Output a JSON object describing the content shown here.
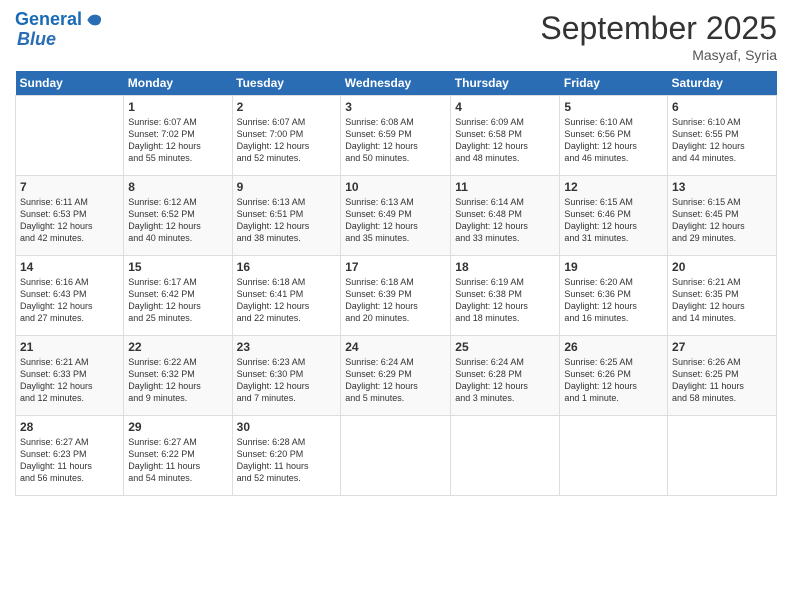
{
  "header": {
    "logo_line1": "General",
    "logo_line2": "Blue",
    "month": "September 2025",
    "location": "Masyaf, Syria"
  },
  "weekdays": [
    "Sunday",
    "Monday",
    "Tuesday",
    "Wednesday",
    "Thursday",
    "Friday",
    "Saturday"
  ],
  "weeks": [
    [
      {
        "day": "",
        "info": ""
      },
      {
        "day": "1",
        "info": "Sunrise: 6:07 AM\nSunset: 7:02 PM\nDaylight: 12 hours\nand 55 minutes."
      },
      {
        "day": "2",
        "info": "Sunrise: 6:07 AM\nSunset: 7:00 PM\nDaylight: 12 hours\nand 52 minutes."
      },
      {
        "day": "3",
        "info": "Sunrise: 6:08 AM\nSunset: 6:59 PM\nDaylight: 12 hours\nand 50 minutes."
      },
      {
        "day": "4",
        "info": "Sunrise: 6:09 AM\nSunset: 6:58 PM\nDaylight: 12 hours\nand 48 minutes."
      },
      {
        "day": "5",
        "info": "Sunrise: 6:10 AM\nSunset: 6:56 PM\nDaylight: 12 hours\nand 46 minutes."
      },
      {
        "day": "6",
        "info": "Sunrise: 6:10 AM\nSunset: 6:55 PM\nDaylight: 12 hours\nand 44 minutes."
      }
    ],
    [
      {
        "day": "7",
        "info": "Sunrise: 6:11 AM\nSunset: 6:53 PM\nDaylight: 12 hours\nand 42 minutes."
      },
      {
        "day": "8",
        "info": "Sunrise: 6:12 AM\nSunset: 6:52 PM\nDaylight: 12 hours\nand 40 minutes."
      },
      {
        "day": "9",
        "info": "Sunrise: 6:13 AM\nSunset: 6:51 PM\nDaylight: 12 hours\nand 38 minutes."
      },
      {
        "day": "10",
        "info": "Sunrise: 6:13 AM\nSunset: 6:49 PM\nDaylight: 12 hours\nand 35 minutes."
      },
      {
        "day": "11",
        "info": "Sunrise: 6:14 AM\nSunset: 6:48 PM\nDaylight: 12 hours\nand 33 minutes."
      },
      {
        "day": "12",
        "info": "Sunrise: 6:15 AM\nSunset: 6:46 PM\nDaylight: 12 hours\nand 31 minutes."
      },
      {
        "day": "13",
        "info": "Sunrise: 6:15 AM\nSunset: 6:45 PM\nDaylight: 12 hours\nand 29 minutes."
      }
    ],
    [
      {
        "day": "14",
        "info": "Sunrise: 6:16 AM\nSunset: 6:43 PM\nDaylight: 12 hours\nand 27 minutes."
      },
      {
        "day": "15",
        "info": "Sunrise: 6:17 AM\nSunset: 6:42 PM\nDaylight: 12 hours\nand 25 minutes."
      },
      {
        "day": "16",
        "info": "Sunrise: 6:18 AM\nSunset: 6:41 PM\nDaylight: 12 hours\nand 22 minutes."
      },
      {
        "day": "17",
        "info": "Sunrise: 6:18 AM\nSunset: 6:39 PM\nDaylight: 12 hours\nand 20 minutes."
      },
      {
        "day": "18",
        "info": "Sunrise: 6:19 AM\nSunset: 6:38 PM\nDaylight: 12 hours\nand 18 minutes."
      },
      {
        "day": "19",
        "info": "Sunrise: 6:20 AM\nSunset: 6:36 PM\nDaylight: 12 hours\nand 16 minutes."
      },
      {
        "day": "20",
        "info": "Sunrise: 6:21 AM\nSunset: 6:35 PM\nDaylight: 12 hours\nand 14 minutes."
      }
    ],
    [
      {
        "day": "21",
        "info": "Sunrise: 6:21 AM\nSunset: 6:33 PM\nDaylight: 12 hours\nand 12 minutes."
      },
      {
        "day": "22",
        "info": "Sunrise: 6:22 AM\nSunset: 6:32 PM\nDaylight: 12 hours\nand 9 minutes."
      },
      {
        "day": "23",
        "info": "Sunrise: 6:23 AM\nSunset: 6:30 PM\nDaylight: 12 hours\nand 7 minutes."
      },
      {
        "day": "24",
        "info": "Sunrise: 6:24 AM\nSunset: 6:29 PM\nDaylight: 12 hours\nand 5 minutes."
      },
      {
        "day": "25",
        "info": "Sunrise: 6:24 AM\nSunset: 6:28 PM\nDaylight: 12 hours\nand 3 minutes."
      },
      {
        "day": "26",
        "info": "Sunrise: 6:25 AM\nSunset: 6:26 PM\nDaylight: 12 hours\nand 1 minute."
      },
      {
        "day": "27",
        "info": "Sunrise: 6:26 AM\nSunset: 6:25 PM\nDaylight: 11 hours\nand 58 minutes."
      }
    ],
    [
      {
        "day": "28",
        "info": "Sunrise: 6:27 AM\nSunset: 6:23 PM\nDaylight: 11 hours\nand 56 minutes."
      },
      {
        "day": "29",
        "info": "Sunrise: 6:27 AM\nSunset: 6:22 PM\nDaylight: 11 hours\nand 54 minutes."
      },
      {
        "day": "30",
        "info": "Sunrise: 6:28 AM\nSunset: 6:20 PM\nDaylight: 11 hours\nand 52 minutes."
      },
      {
        "day": "",
        "info": ""
      },
      {
        "day": "",
        "info": ""
      },
      {
        "day": "",
        "info": ""
      },
      {
        "day": "",
        "info": ""
      }
    ]
  ]
}
